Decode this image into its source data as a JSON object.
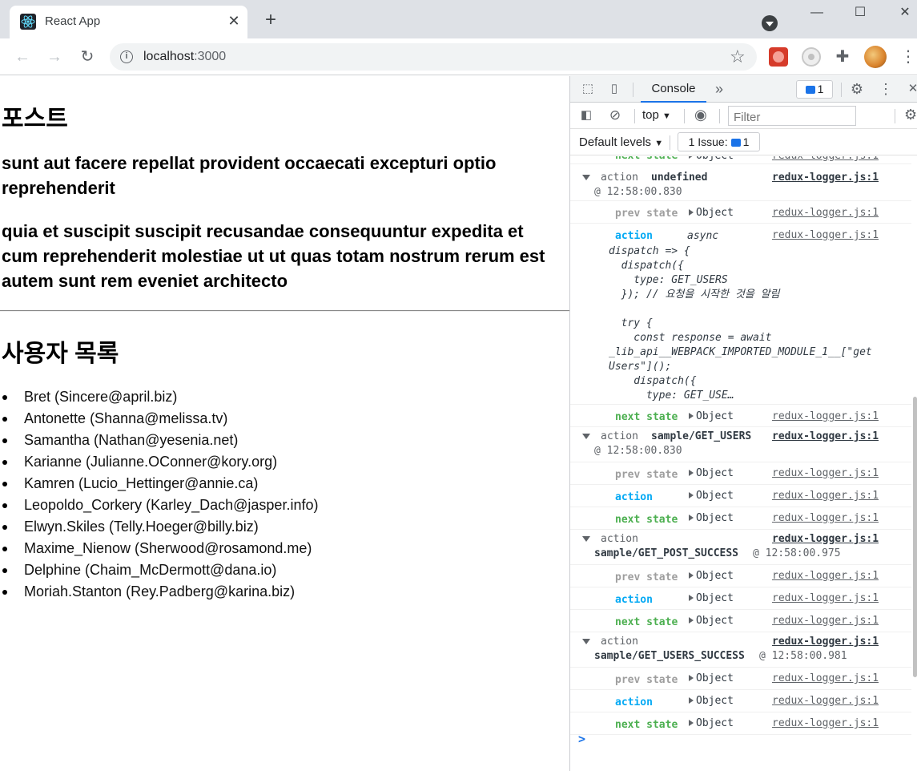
{
  "browser": {
    "tab_title": "React App",
    "url_host": "localhost",
    "url_port": ":3000"
  },
  "page": {
    "heading": "포스트",
    "post_title": "sunt aut facere repellat provident occaecati excepturi optio reprehenderit",
    "post_body": "quia et suscipit suscipit recusandae consequuntur expedita et cum reprehenderit molestiae ut ut quas totam nostrum rerum est autem sunt rem eveniet architecto",
    "users_heading": "사용자 목록",
    "users": [
      "Bret (Sincere@april.biz)",
      "Antonette (Shanna@melissa.tv)",
      "Samantha (Nathan@yesenia.net)",
      "Karianne (Julianne.OConner@kory.org)",
      "Kamren (Lucio_Hettinger@annie.ca)",
      "Leopoldo_Corkery (Karley_Dach@jasper.info)",
      "Elwyn.Skiles (Telly.Hoeger@billy.biz)",
      "Maxime_Nienow (Sherwood@rosamond.me)",
      "Delphine (Chaim_McDermott@dana.io)",
      "Moriah.Stanton (Rey.Padberg@karina.biz)"
    ]
  },
  "devtools": {
    "console_tab": "Console",
    "issues_count": "1",
    "context": "top",
    "filter_placeholder": "Filter",
    "levels": "Default levels",
    "issue_chip": "1 Issue:",
    "issue_chip_count": "1",
    "source": "redux-logger.js:1",
    "prev_state": "prev state",
    "action": "action",
    "next_state": "next state",
    "object": "Object",
    "async_label": "async",
    "groups": [
      {
        "action_word": "action",
        "type": "undefined",
        "time": "@ 12:58:00.830"
      },
      {
        "action_word": "action",
        "type": "sample/GET_USERS",
        "time": "@ 12:58:00.830"
      },
      {
        "action_word": "action",
        "type": "sample/GET_POST_SUCCESS",
        "time": "@ 12:58:00.975"
      },
      {
        "action_word": "action",
        "type": "sample/GET_USERS_SUCCESS",
        "time": "@ 12:58:00.981"
      }
    ],
    "code_lines": [
      "dispatch => {",
      "  dispatch({",
      "    type: GET_USERS",
      "  }); // 요청을 시작한 것을 알림",
      "",
      "  try {",
      "    const response = await",
      "_lib_api__WEBPACK_IMPORTED_MODULE_1__[\"get",
      "Users\"]();",
      "    dispatch({",
      "      type: GET_USE…"
    ],
    "prompt": ">"
  }
}
